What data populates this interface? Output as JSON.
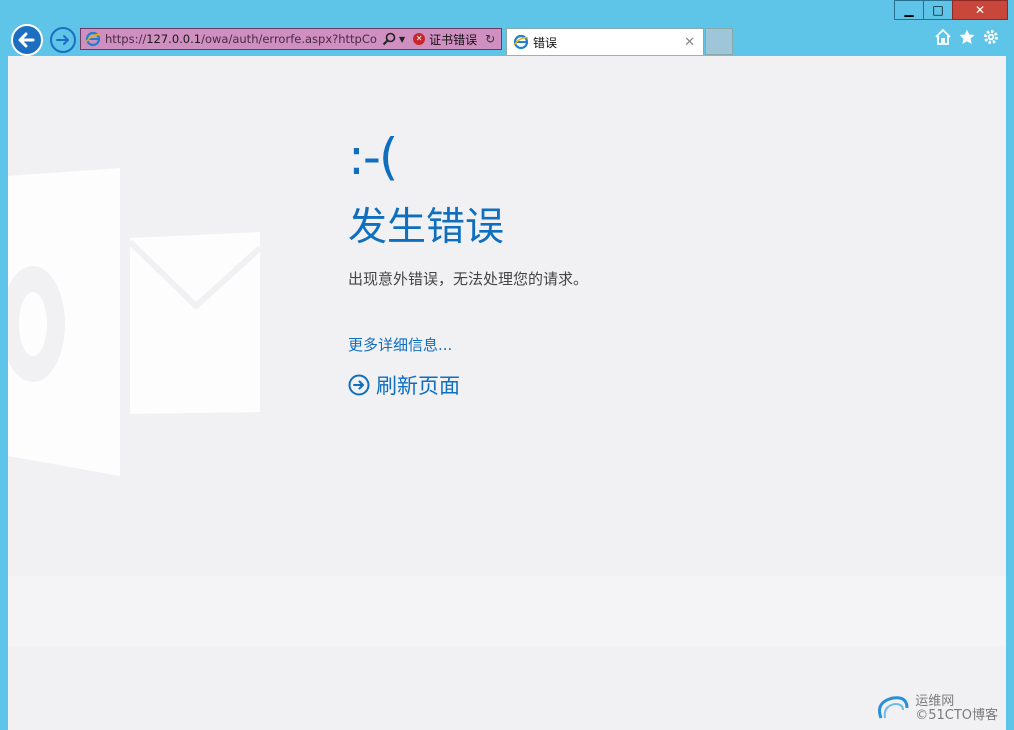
{
  "browser": {
    "address": {
      "url_prefix": "https://",
      "url_host": "127.0.0.1",
      "url_path": "/owa/auth/errorfe.aspx?httpCo",
      "cert_error": "证书错误"
    },
    "tab": {
      "label": "错误"
    },
    "window_controls": {
      "minimize": "▁",
      "maximize": "□",
      "close": "✕"
    },
    "icons": [
      "back-icon",
      "forward-icon",
      "ie-icon",
      "search-icon",
      "refresh-icon",
      "home-icon",
      "favorites-star-icon",
      "settings-gear-icon"
    ]
  },
  "page": {
    "face": ":-(",
    "title": "发生错误",
    "description": "出现意外错误，无法处理您的请求。",
    "more_details": "更多详细信息...",
    "refresh_label": "刷新页面"
  },
  "watermark": {
    "line1": "运维网",
    "line2": "©51CTO博客"
  },
  "colors": {
    "accent": "#106ebe",
    "chrome": "#5ec4e8",
    "content_bg": "#f1f1f4",
    "cert_error_bar": "#cf8fc1"
  }
}
